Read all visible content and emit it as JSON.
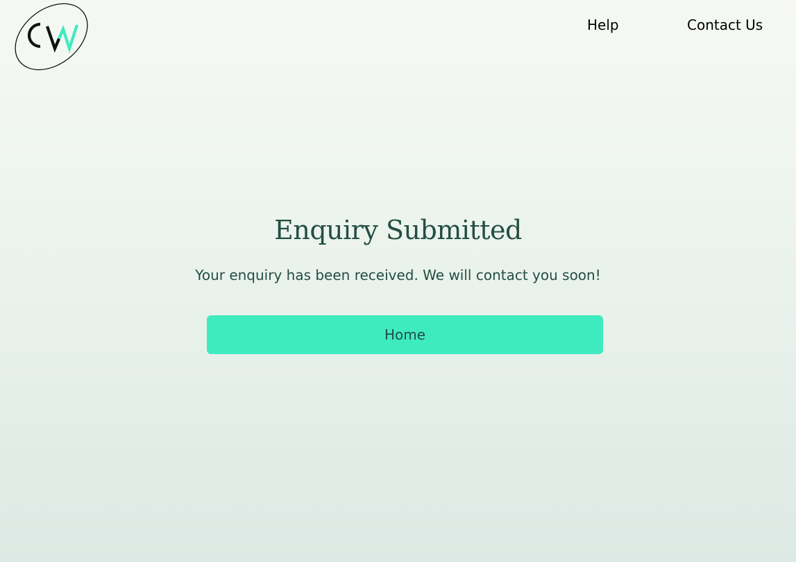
{
  "logo": {
    "icon": "cw-logo-icon",
    "letters": "CW",
    "colors": {
      "c": "#111111",
      "w": "#3eebbf",
      "ring": "#111111"
    }
  },
  "nav": {
    "help_label": "Help",
    "contact_label": "Contact Us"
  },
  "main": {
    "title": "Enquiry Submitted",
    "message": "Your enquiry has been received. We will contact you soon!",
    "home_button_label": "Home"
  },
  "colors": {
    "accent": "#3eebbf",
    "text_dark_green": "#234e45",
    "background_top": "#f6f9f3",
    "background_bottom": "#dde9e4"
  }
}
